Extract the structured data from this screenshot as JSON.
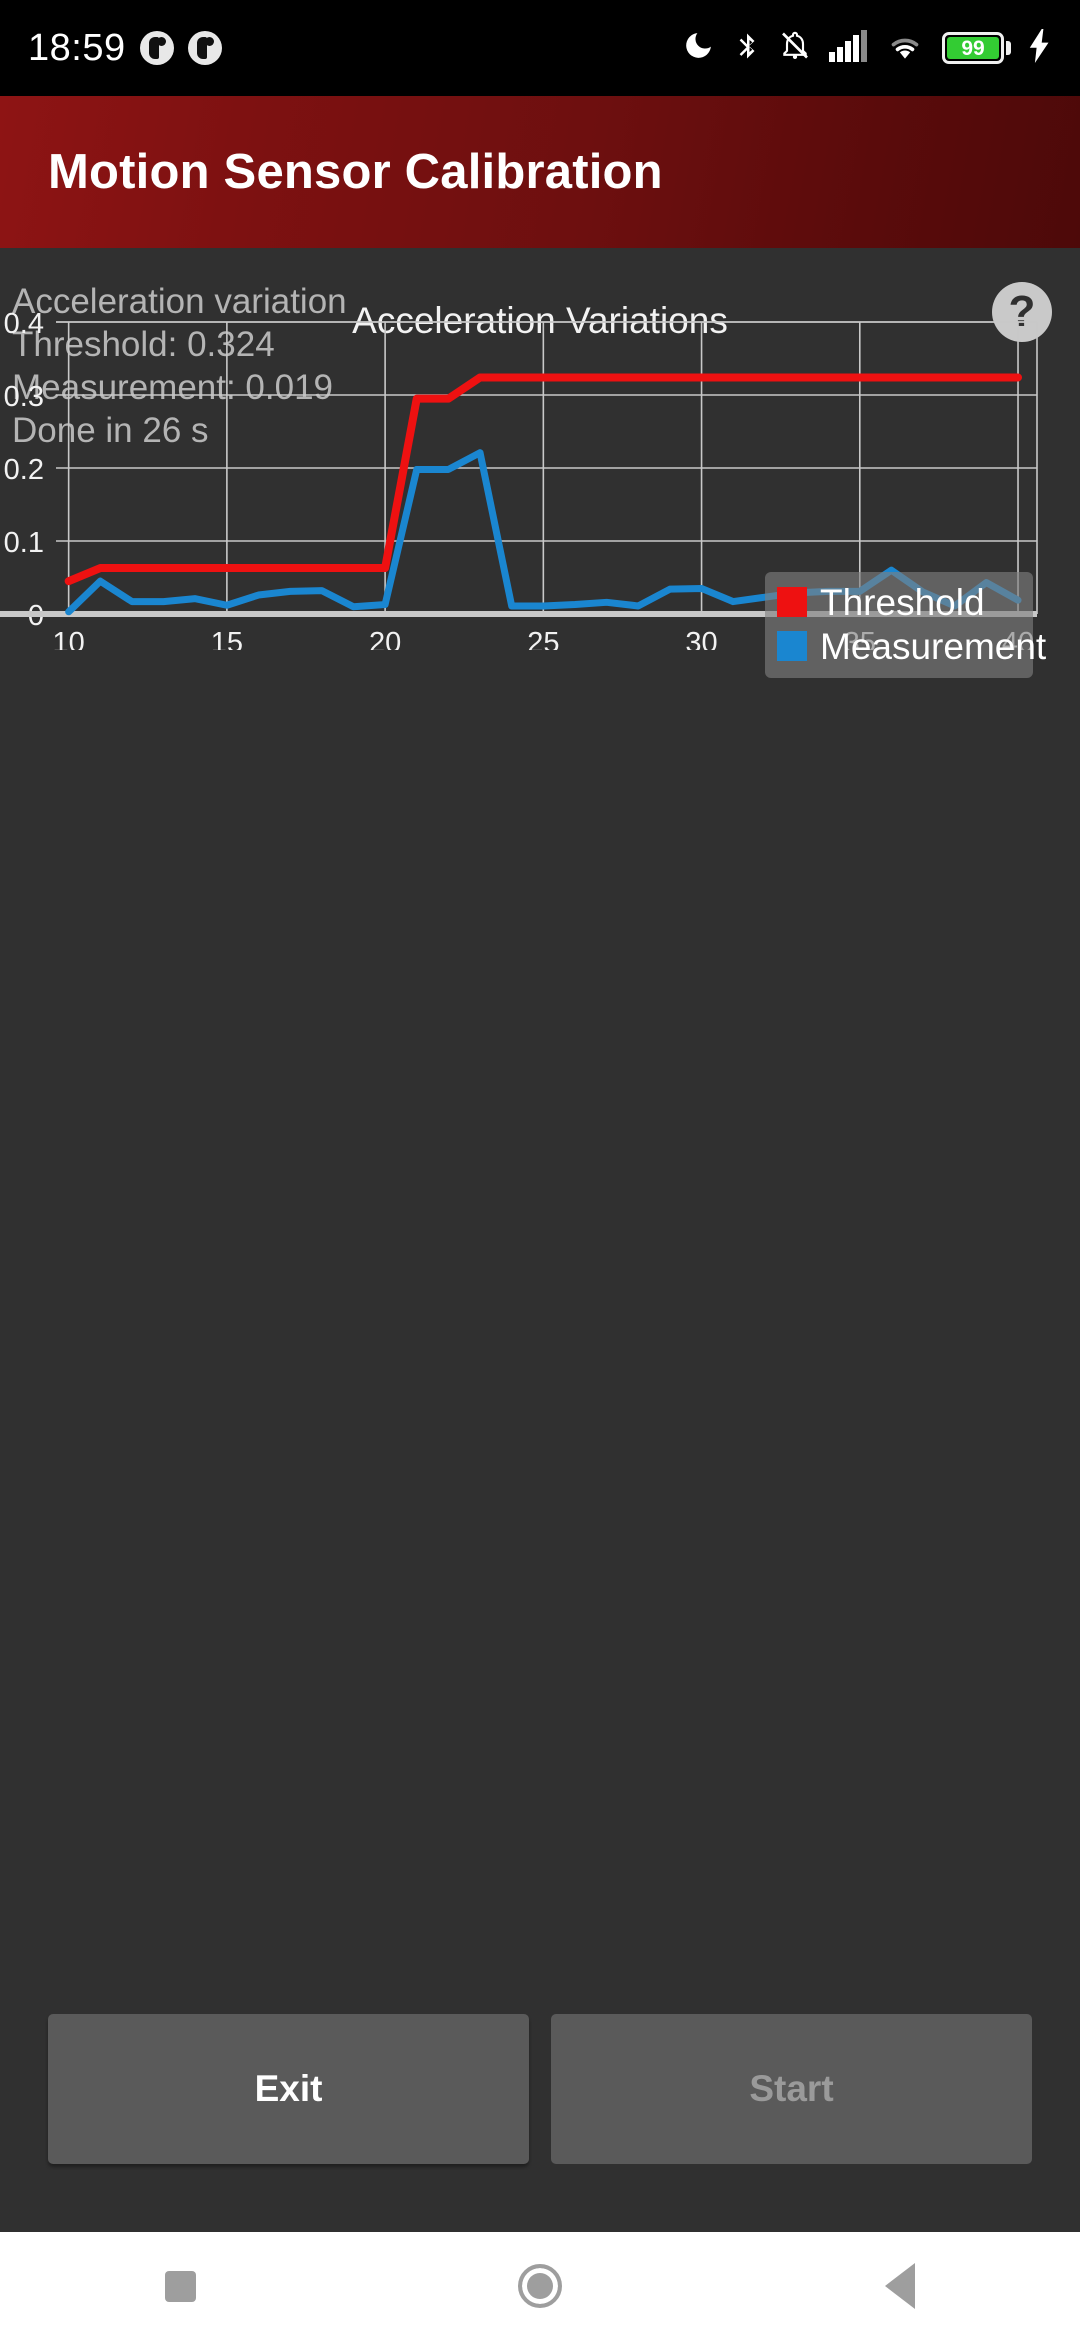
{
  "status_bar": {
    "time": "18:59",
    "icons": [
      "notification-dot-icon",
      "notification-dot-icon",
      "do-not-disturb-moon-icon",
      "bluetooth-icon",
      "mute-bell-icon",
      "cellular-signal-icon",
      "wifi-icon",
      "battery-icon",
      "charging-bolt-icon"
    ],
    "battery_percent": "99",
    "battery_color": "#33cc33"
  },
  "app_bar": {
    "title": "Motion Sensor Calibration",
    "background_color": "#7e1111"
  },
  "info": {
    "line1": "Acceleration variation",
    "line2": "Threshold: 0.324",
    "line3": "Measurement: 0.019",
    "line4": "Done in 26 s",
    "help_label": "?"
  },
  "buttons": {
    "exit_label": "Exit",
    "start_label": "Start",
    "start_enabled": false
  },
  "nav_bar": {
    "recents_label": "recents-square-icon",
    "home_label": "home-circle-icon",
    "back_label": "back-triangle-icon"
  },
  "chart_data": {
    "type": "line",
    "title": "Acceleration Variations",
    "xlabel": "",
    "ylabel": "",
    "xlim": [
      9.6,
      40.6
    ],
    "ylim": [
      0,
      0.4
    ],
    "xticks": [
      10,
      15,
      20,
      25,
      30,
      35,
      40
    ],
    "yticks": [
      0,
      0.1,
      0.2,
      0.3,
      0.4
    ],
    "ytick_labels": [
      "0",
      "0.1",
      "0.2",
      "0.3",
      "0.4"
    ],
    "grid": true,
    "legend_position": "top-right",
    "background_color": "#303030",
    "x": [
      10,
      11,
      12,
      13,
      14,
      15,
      16,
      17,
      18,
      19,
      20,
      21,
      22,
      23,
      24,
      25,
      26,
      27,
      28,
      29,
      30,
      31,
      32,
      33,
      34,
      35,
      36,
      37,
      38,
      39,
      40
    ],
    "series": [
      {
        "name": "Threshold",
        "color": "#ee1111",
        "values": [
          0.045,
          0.063,
          0.063,
          0.063,
          0.063,
          0.063,
          0.063,
          0.063,
          0.063,
          0.063,
          0.063,
          0.295,
          0.295,
          0.324,
          0.324,
          0.324,
          0.324,
          0.324,
          0.324,
          0.324,
          0.324,
          0.324,
          0.324,
          0.324,
          0.324,
          0.324,
          0.324,
          0.324,
          0.324,
          0.324,
          0.324
        ]
      },
      {
        "name": "Measurement",
        "color": "#1a86d0",
        "values": [
          0.003,
          0.045,
          0.017,
          0.017,
          0.021,
          0.012,
          0.026,
          0.031,
          0.032,
          0.01,
          0.013,
          0.198,
          0.198,
          0.221,
          0.011,
          0.011,
          0.013,
          0.016,
          0.011,
          0.034,
          0.035,
          0.017,
          0.023,
          0.029,
          0.031,
          0.031,
          0.06,
          0.03,
          0.011,
          0.043,
          0.019
        ]
      }
    ],
    "legend": [
      "Threshold",
      "Measurement"
    ]
  }
}
